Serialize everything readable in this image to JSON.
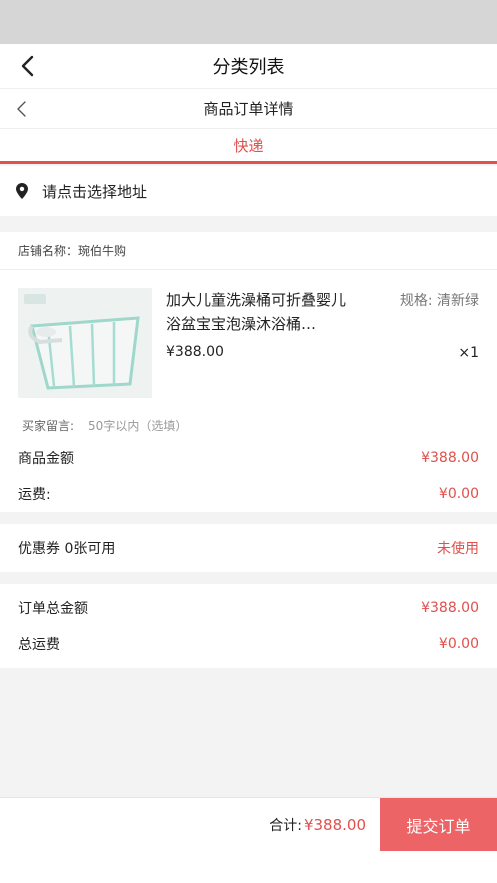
{
  "nav": {
    "title": "分类列表"
  },
  "subnav": {
    "title": "商品订单详情"
  },
  "delivery": {
    "label": "快递"
  },
  "address": {
    "placeholder_text": "请点击选择地址"
  },
  "store": {
    "name_label": "店铺名称：琬伯牛购"
  },
  "product": {
    "name": "加大儿童洗澡桶可折叠婴儿浴盆宝宝泡澡沐浴桶…",
    "spec": "规格: 清新绿",
    "price": "¥388.00",
    "qty": "×1"
  },
  "memo": {
    "label": "买家留言:",
    "placeholder": "50字以内（选填）"
  },
  "amounts": {
    "goods_label": "商品金额",
    "goods_value": "¥388.00",
    "shipping_label": "运费:",
    "shipping_value": "¥0.00"
  },
  "coupon": {
    "label": "优惠券 0张可用",
    "status": "未使用"
  },
  "totals": {
    "order_total_label": "订单总金额",
    "order_total_value": "¥388.00",
    "total_shipping_label": "总运费",
    "total_shipping_value": "¥0.00"
  },
  "footer": {
    "sum_label": "合计:",
    "sum_value": "¥388.00",
    "submit_label": "提交订单"
  },
  "colors": {
    "accent": "#e0504d",
    "button": "#ed6466"
  }
}
